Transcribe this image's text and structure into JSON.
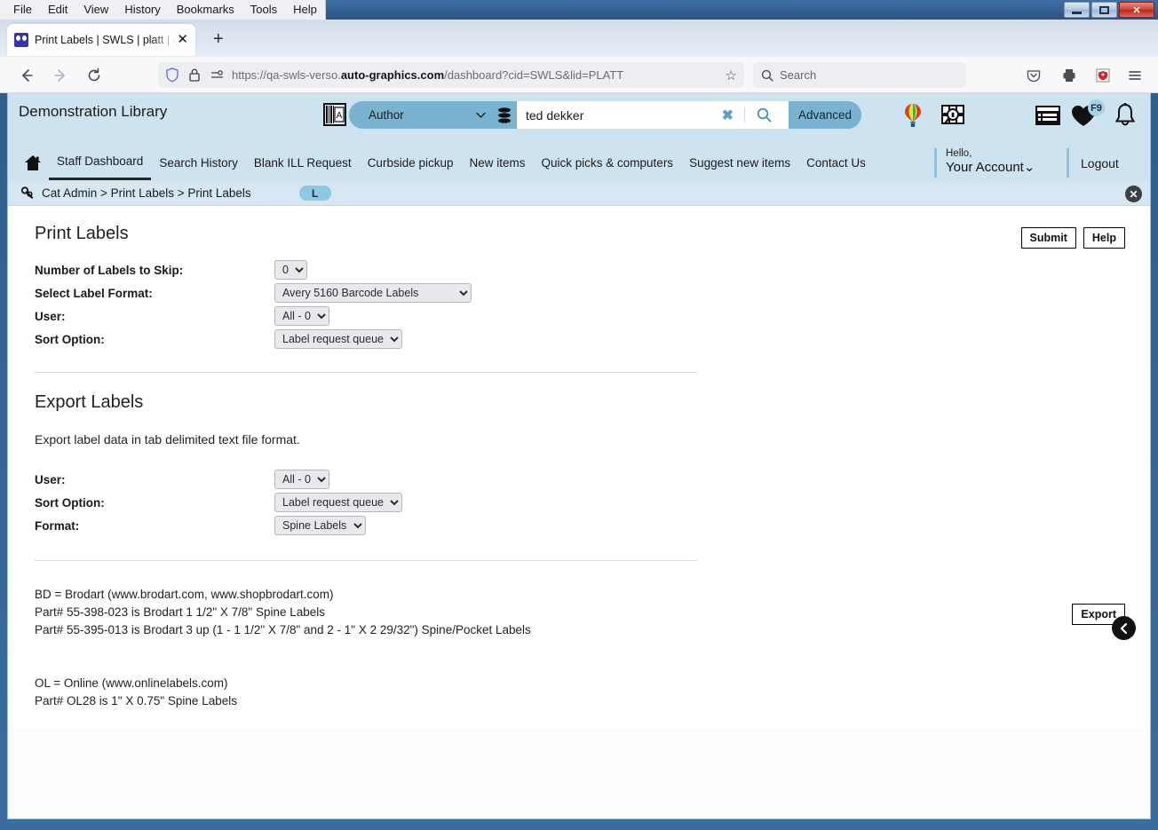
{
  "browser": {
    "menus": [
      "File",
      "Edit",
      "View",
      "History",
      "Bookmarks",
      "Tools",
      "Help"
    ],
    "tab_title": "Print Labels | SWLS | platt | Auto",
    "url_prefix": "https://qa-swls-verso.",
    "url_domain": "auto-graphics.com",
    "url_suffix": "/dashboard?cid=SWLS&lid=PLATT",
    "search_placeholder": "Search"
  },
  "header": {
    "library_name": "Demonstration Library",
    "search_index": "Author",
    "search_value": "ted dekker",
    "advanced_label": "Advanced",
    "badge_f9": "F9"
  },
  "nav": {
    "items": [
      {
        "label": "Staff Dashboard",
        "active": true
      },
      {
        "label": "Search History",
        "active": false
      },
      {
        "label": "Blank ILL Request",
        "active": false
      },
      {
        "label": "Curbside pickup",
        "active": false
      },
      {
        "label": "New items",
        "active": false
      },
      {
        "label": "Quick picks & computers",
        "active": false
      },
      {
        "label": "Suggest new items",
        "active": false
      },
      {
        "label": "Contact Us",
        "active": false
      }
    ],
    "hello": "Hello,",
    "account": "Your Account",
    "logout": "Logout"
  },
  "breadcrumb": {
    "text": "Cat Admin > Print Labels > Print Labels",
    "badge": "L"
  },
  "print_labels": {
    "title": "Print Labels",
    "submit_label": "Submit",
    "help_label": "Help",
    "fields": [
      {
        "label": "Number of Labels to Skip:",
        "value": "0"
      },
      {
        "label": "Select Label Format:",
        "value": "Avery 5160 Barcode Labels"
      },
      {
        "label": "User:",
        "value": "All - 0"
      },
      {
        "label": "Sort Option:",
        "value": "Label request queue"
      }
    ]
  },
  "export_labels": {
    "title": "Export Labels",
    "export_label": "Export",
    "description": "Export label data in tab delimited text file format.",
    "fields": [
      {
        "label": "User:",
        "value": "All - 0"
      },
      {
        "label": "Sort Option:",
        "value": "Label request queue"
      },
      {
        "label": "Format:",
        "value": "Spine Labels"
      }
    ]
  },
  "footnotes": {
    "line1": "BD = Brodart (www.brodart.com, www.shopbrodart.com)",
    "line2": "Part# 55-398-023 is Brodart 1 1/2\" X 7/8\" Spine Labels",
    "line3": "Part# 55-395-013 is Brodart 3 up (1 - 1 1/2\" X 7/8\" and 2 - 1\" X 2 29/32\") Spine/Pocket Labels",
    "line4": "OL = Online (www.onlinelabels.com)",
    "line5": "Part# OL28 is 1\" X 0.75\" Spine Labels"
  },
  "colors": {
    "header_bg": "#cde3ef",
    "accent": "#79b3d0",
    "crumb_bg": "#d7e7f1"
  }
}
